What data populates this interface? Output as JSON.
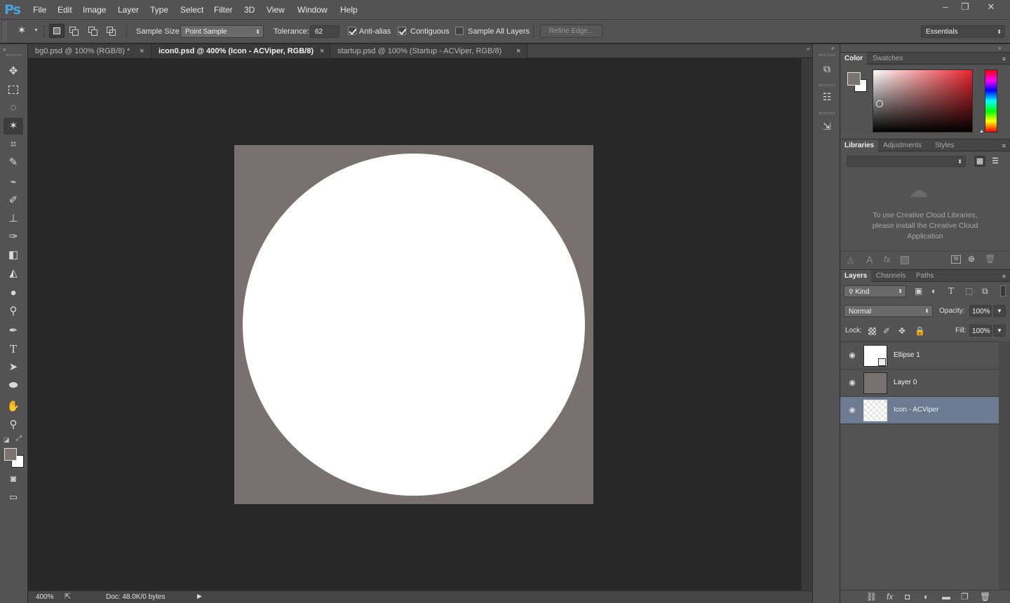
{
  "app": {
    "logo": "Ps"
  },
  "menubar": {
    "items": [
      "File",
      "Edit",
      "Image",
      "Layer",
      "Type",
      "Select",
      "Filter",
      "3D",
      "View",
      "Window",
      "Help"
    ]
  },
  "window_controls": {
    "minimize": "–",
    "restore": "❐",
    "close": "✕"
  },
  "options": {
    "sample_size_label": "Sample Size:",
    "sample_size_value": "Point Sample",
    "tolerance_label": "Tolerance:",
    "tolerance_value": "62",
    "anti_alias_label": "Anti-alias",
    "anti_alias_checked": true,
    "contiguous_label": "Contiguous",
    "contiguous_checked": true,
    "sample_all_label": "Sample All Layers",
    "sample_all_checked": false,
    "refine_edge_label": "Refine Edge...",
    "workspace_value": "Essentials"
  },
  "tabs": [
    {
      "label": "bg0.psd @ 100% (RGB/8) *",
      "active": false
    },
    {
      "label": "icon0.psd @ 400% (Icon - ACViper, RGB/8)",
      "active": true
    },
    {
      "label": "startup.psd @ 100% (Startup - ACViper, RGB/8)",
      "active": false
    }
  ],
  "document": {
    "bg_color": "#797170",
    "shape_color": "#ffffff"
  },
  "status": {
    "zoom": "400%",
    "doc_info": "Doc: 48.0K/0 bytes"
  },
  "color_panel": {
    "tabs": [
      "Color",
      "Swatches"
    ],
    "fg": "#7a7272",
    "bg": "#ffffff"
  },
  "libraries_panel": {
    "tabs": [
      "Libraries",
      "Adjustments",
      "Styles"
    ],
    "message": "To use Creative Cloud Libraries, please install the Creative Cloud Application"
  },
  "layers_panel": {
    "tabs": [
      "Layers",
      "Channels",
      "Paths"
    ],
    "kind_label": "Kind",
    "blend_mode": "Normal",
    "opacity_label": "Opacity:",
    "opacity_value": "100%",
    "lock_label": "Lock:",
    "fill_label": "Fill:",
    "fill_value": "100%",
    "layers": [
      {
        "name": "Ellipse 1",
        "selected": false
      },
      {
        "name": "Layer 0",
        "selected": false
      },
      {
        "name": "Icon - ACViper",
        "selected": true
      }
    ]
  }
}
